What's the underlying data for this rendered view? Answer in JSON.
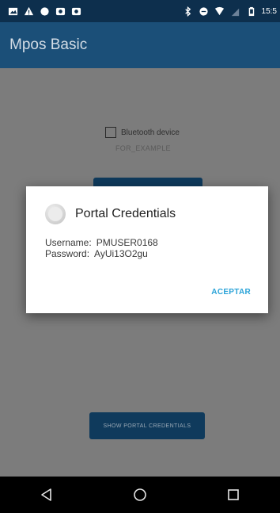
{
  "status_bar": {
    "time": "15:5",
    "left_icons": [
      "gallery-icon",
      "alert-icon",
      "record-icon",
      "sync-icon",
      "image-icon"
    ],
    "right_icons": [
      "bluetooth-icon",
      "data-saver-icon",
      "wifi-icon",
      "signal-icon",
      "battery-icon"
    ]
  },
  "app_bar": {
    "title": "Mpos Basic"
  },
  "main": {
    "bluetooth_checkbox_label": "Bluetooth device",
    "example_text": "FOR_EXAMPLE",
    "portal_button_label": "SHOW PORTAL CREDENTIALS"
  },
  "dialog": {
    "title": "Portal Credentials",
    "username_label": "Username:",
    "username_value": "PMUSER0168",
    "password_label": "Password:",
    "password_value": "AyUi13O2gu",
    "accept_label": "ACEPTAR"
  },
  "nav_bar": {
    "buttons": [
      "back-icon",
      "home-icon",
      "recents-icon"
    ]
  },
  "colors": {
    "app_bar": "#1b4f78",
    "status_bar": "#0d2f4d",
    "accent": "#2aa3d8",
    "dim_background": "#7a7a7a"
  }
}
